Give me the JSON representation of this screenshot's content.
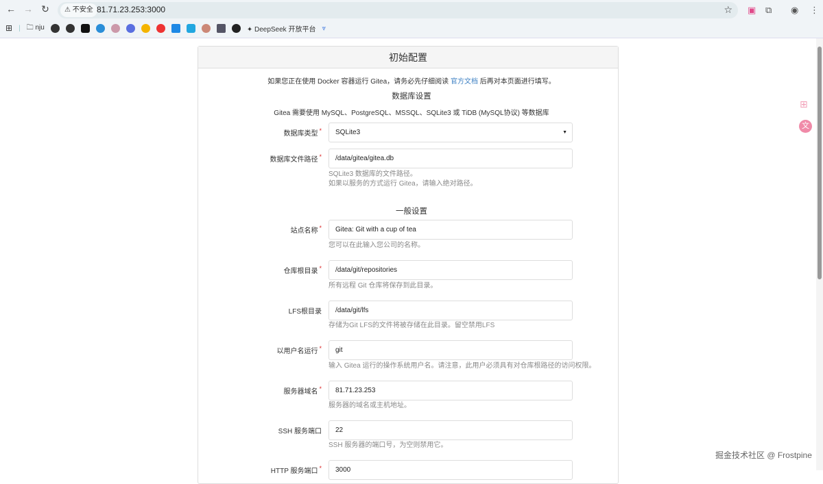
{
  "browser": {
    "security_label": "不安全",
    "url": "81.71.23.253:3000",
    "bookmarks": [
      {
        "label": "nju"
      },
      {
        "label": "DeepSeek 开放平台"
      }
    ]
  },
  "page": {
    "title": "初始配置",
    "docker_notice_pre": "如果您正在使用 Docker 容器运行 Gitea，请务必先仔细阅读",
    "docker_notice_link": "官方文档",
    "docker_notice_post": "后再对本页面进行填写。",
    "db_section": "数据库设置",
    "db_note": "Gitea 需要使用 MySQL、PostgreSQL、MSSQL、SQLite3 或 TiDB (MySQL协议) 等数据库",
    "general_section": "一般设置",
    "fields": {
      "db_type": {
        "label": "数据库类型",
        "value": "SQLite3"
      },
      "db_path": {
        "label": "数据库文件路径",
        "value": "/data/gitea/gitea.db",
        "help1": "SQLite3 数据库的文件路径。",
        "help2": "如果以服务的方式运行 Gitea，请输入绝对路径。"
      },
      "site_name": {
        "label": "站点名称",
        "value": "Gitea: Git with a cup of tea",
        "help": "您可以在此输入您公司的名称。"
      },
      "repo_root": {
        "label": "仓库根目录",
        "value": "/data/git/repositories",
        "help": "所有远程 Git 仓库将保存到此目录。"
      },
      "lfs_root": {
        "label": "LFS根目录",
        "value": "/data/git/lfs",
        "help": "存储为Git LFS的文件将被存储在此目录。留空禁用LFS"
      },
      "run_user": {
        "label": "以用户名运行",
        "value": "git",
        "help": "输入 Gitea 运行的操作系统用户名。请注意，此用户必须具有对仓库根路径的访问权限。"
      },
      "domain": {
        "label": "服务器域名",
        "value": "81.71.23.253",
        "help": "服务器的域名或主机地址。"
      },
      "ssh_port": {
        "label": "SSH 服务端口",
        "value": "22",
        "help": "SSH 服务器的端口号，为空则禁用它。"
      },
      "http_port": {
        "label": "HTTP 服务端口",
        "value": "3000"
      }
    },
    "required_mark": "*"
  },
  "watermark": "掘金技术社区 @ Frostpine"
}
